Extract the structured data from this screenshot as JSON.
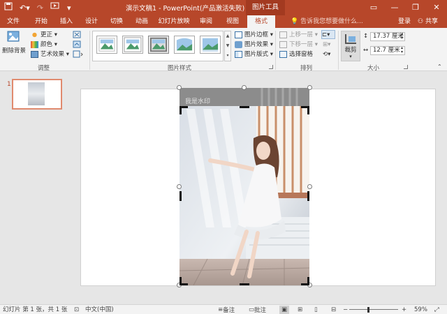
{
  "titlebar": {
    "title": "演示文稿1 - PowerPoint(产品激活失败)",
    "context_tab_title": "图片工具",
    "min": "—",
    "restore": "❐",
    "close": "✕"
  },
  "tabs": [
    {
      "label": "文件"
    },
    {
      "label": "开始"
    },
    {
      "label": "插入"
    },
    {
      "label": "设计"
    },
    {
      "label": "切换"
    },
    {
      "label": "动画"
    },
    {
      "label": "幻灯片放映"
    },
    {
      "label": "审阅"
    },
    {
      "label": "视图"
    },
    {
      "label": "格式"
    }
  ],
  "tell_me": "告诉我您想要做什么...",
  "login": "登录",
  "share": "共享",
  "ribbon": {
    "adjust": {
      "remove_bg": "删除背景",
      "corrections": "更正",
      "color": "颜色",
      "artistic": "艺术效果",
      "label": "调整"
    },
    "styles": {
      "label": "图片样式",
      "border": "图片边框",
      "effects": "图片效果",
      "layout": "图片版式"
    },
    "arrange": {
      "label": "排列",
      "bring_forward": "上移一层",
      "send_backward": "下移一层",
      "selection_pane": "选择窗格"
    },
    "size": {
      "label": "大小",
      "crop": "裁剪",
      "height": "17.37 厘米",
      "width": "12.7 厘米"
    }
  },
  "slide_pane": {
    "number": "1"
  },
  "canvas": {
    "watermark": "我是水印"
  },
  "statusbar": {
    "slide_info": "幻灯片 第 1 张，共 1 张",
    "language": "中文(中国)",
    "notes": "备注",
    "comments": "批注",
    "zoom": "59%"
  },
  "colors": {
    "accent": "#b7472a"
  }
}
